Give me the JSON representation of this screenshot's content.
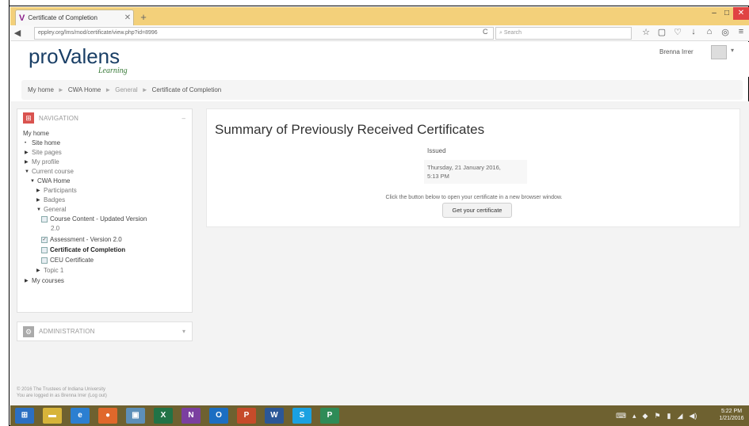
{
  "browser": {
    "tab_title": "Certificate of Completion",
    "tab_icon": "V",
    "url": "eppley.org/lms/mod/certificate/view.php?id=8996",
    "search_placeholder": "Search"
  },
  "site": {
    "logo_main": "proValens",
    "logo_sub": "Learning",
    "user_name": "Brenna Irrer"
  },
  "breadcrumb": [
    "My home",
    "CWA Home",
    "General",
    "Certificate of Completion"
  ],
  "navigation": {
    "title": "NAVIGATION",
    "items": [
      {
        "label": "My home"
      },
      {
        "label": "Site home"
      },
      {
        "label": "Site pages"
      },
      {
        "label": "My profile"
      },
      {
        "label": "Current course"
      },
      {
        "label": "CWA Home"
      },
      {
        "label": "Participants"
      },
      {
        "label": "Badges"
      },
      {
        "label": "General"
      },
      {
        "label": "Course Content - Updated Version"
      },
      {
        "label": "2.0"
      },
      {
        "label": "Assessment - Version 2.0"
      },
      {
        "label": "Certificate of Completion"
      },
      {
        "label": "CEU Certificate"
      },
      {
        "label": "Topic 1"
      },
      {
        "label": "My courses"
      }
    ]
  },
  "administration": {
    "title": "ADMINISTRATION"
  },
  "footer": {
    "line1": "© 2016 The Trustees of Indiana University",
    "line2": "You are logged in as Brenna Irrer (Log out)"
  },
  "main": {
    "heading": "Summary of Previously Received Certificates",
    "column_header": "Issued",
    "issued_line1": "Thursday, 21 January 2016,",
    "issued_line2": "5:13 PM",
    "note": "Click the button below to open your certificate in a new browser window.",
    "button": "Get your certificate"
  },
  "taskbar": {
    "time": "5:22 PM",
    "date": "1/21/2016"
  }
}
